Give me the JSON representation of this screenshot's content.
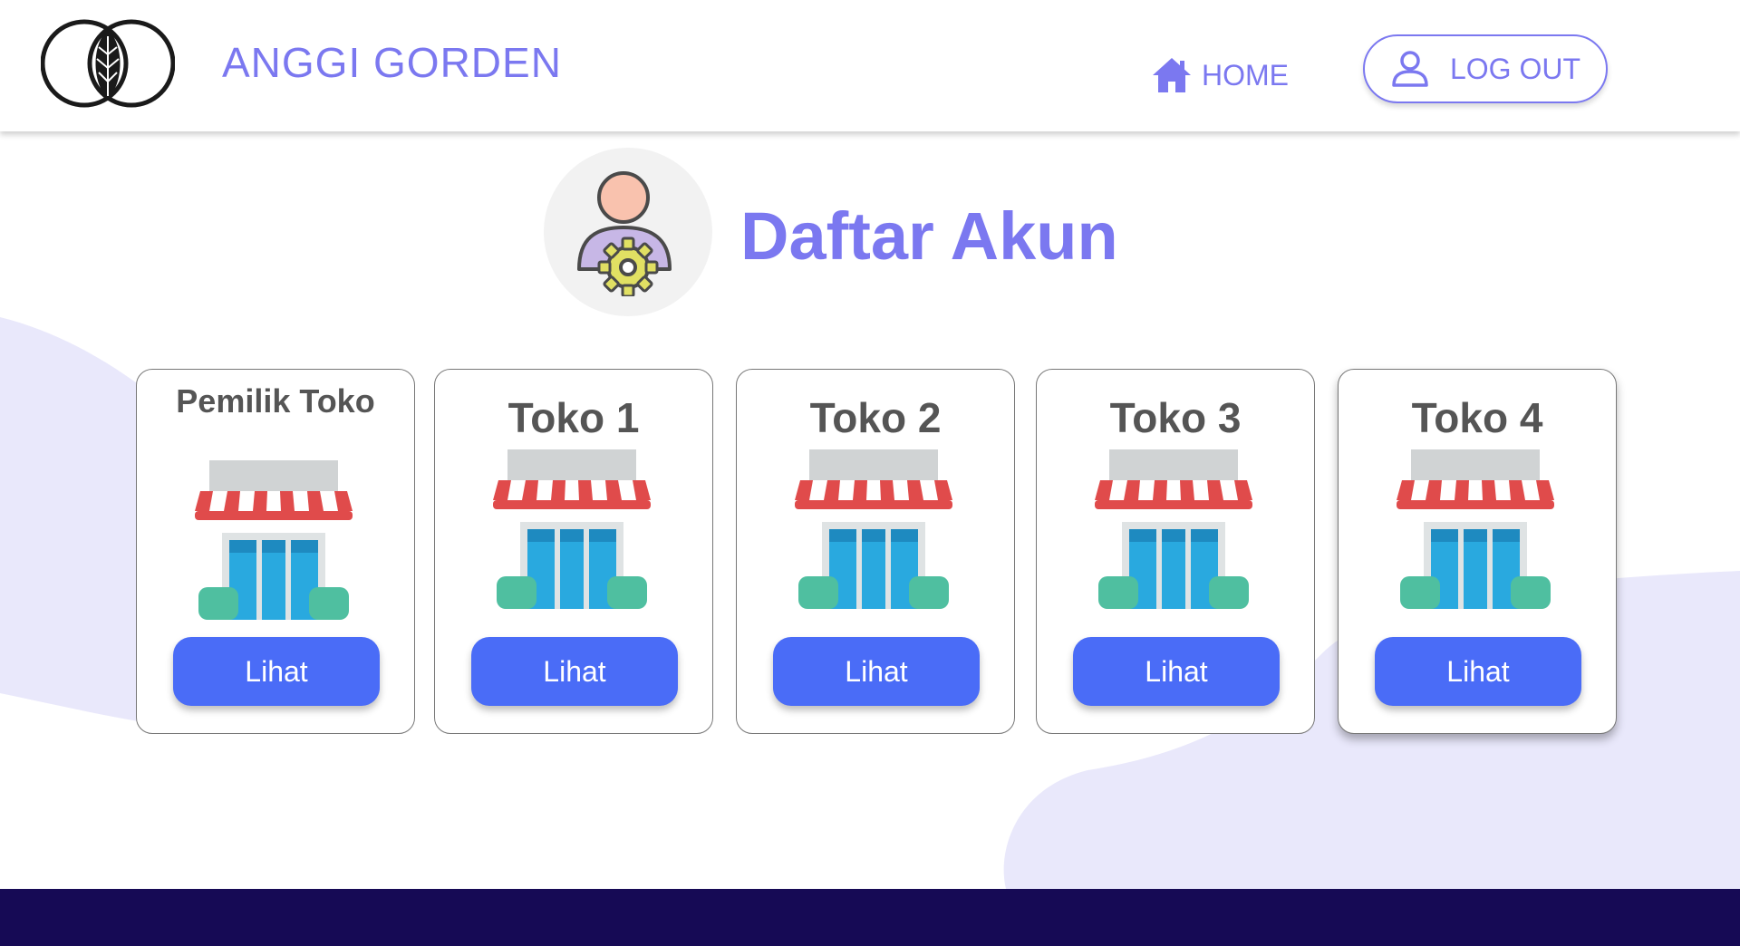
{
  "header": {
    "brand": "ANGGI GORDEN",
    "nav_home": "HOME",
    "logout": "LOG OUT"
  },
  "page": {
    "title": "Daftar Akun"
  },
  "cards": [
    {
      "title": "Pemilik Toko",
      "button": "Lihat"
    },
    {
      "title": "Toko 1",
      "button": "Lihat"
    },
    {
      "title": "Toko 2",
      "button": "Lihat"
    },
    {
      "title": "Toko 3",
      "button": "Lihat"
    },
    {
      "title": "Toko 4",
      "button": "Lihat"
    }
  ],
  "colors": {
    "accent": "#7b78f0",
    "button": "#4a6cf7",
    "footer": "#160a55",
    "blob": "#e9e8fb"
  },
  "icons": {
    "logo": "leaf-circles-logo",
    "home": "home-icon",
    "logout": "user-icon",
    "avatar": "user-gear-icon",
    "store": "store-icon"
  }
}
